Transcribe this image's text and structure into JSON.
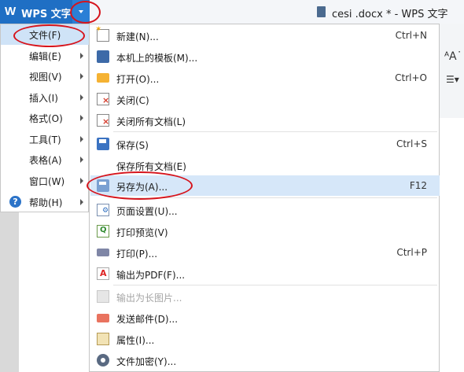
{
  "app": {
    "logo": "W",
    "name": "WPS 文字",
    "doc_title": "cesi .docx * - WPS 文字"
  },
  "background": {
    "toolbar_glyph_1": "ᴬA˙",
    "toolbar_glyph_2": "☰▾"
  },
  "left_menu": [
    {
      "label": "文件(F)",
      "arrow": false,
      "selected": true
    },
    {
      "label": "编辑(E)",
      "arrow": true
    },
    {
      "label": "视图(V)",
      "arrow": true
    },
    {
      "label": "插入(I)",
      "arrow": true
    },
    {
      "label": "格式(O)",
      "arrow": true
    },
    {
      "label": "工具(T)",
      "arrow": true
    },
    {
      "label": "表格(A)",
      "arrow": true
    },
    {
      "label": "窗口(W)",
      "arrow": true
    },
    {
      "label": "帮助(H)",
      "arrow": true,
      "icon": "help-icon",
      "icon_glyph": "?"
    }
  ],
  "file_menu": [
    {
      "label": "新建(N)...",
      "shortcut": "Ctrl+N",
      "icon": "new-doc-icon"
    },
    {
      "label": "本机上的模板(M)...",
      "shortcut": "",
      "icon": "template-icon"
    },
    {
      "label": "打开(O)...",
      "shortcut": "Ctrl+O",
      "icon": "open-folder-icon"
    },
    {
      "label": "关闭(C)",
      "shortcut": "",
      "icon": "close-doc-icon"
    },
    {
      "label": "关闭所有文档(L)",
      "shortcut": "",
      "icon": "close-all-icon"
    },
    {
      "label": "保存(S)",
      "shortcut": "Ctrl+S",
      "icon": "save-icon"
    },
    {
      "label": "保存所有文档(E)",
      "shortcut": "",
      "icon": ""
    },
    {
      "label": "另存为(A)...",
      "shortcut": "F12",
      "icon": "save-as-icon",
      "highlighted": true
    },
    {
      "label": "页面设置(U)...",
      "shortcut": "",
      "icon": "page-setup-icon"
    },
    {
      "label": "打印预览(V)",
      "shortcut": "",
      "icon": "print-preview-icon"
    },
    {
      "label": "打印(P)...",
      "shortcut": "Ctrl+P",
      "icon": "printer-icon"
    },
    {
      "label": "输出为PDF(F)...",
      "shortcut": "",
      "icon": "pdf-icon"
    },
    {
      "label": "输出为长图片...",
      "shortcut": "",
      "icon": "long-image-icon",
      "disabled": true
    },
    {
      "label": "发送邮件(D)...",
      "shortcut": "",
      "icon": "mail-icon"
    },
    {
      "label": "属性(I)...",
      "shortcut": "",
      "icon": "properties-icon"
    },
    {
      "label": "文件加密(Y)...",
      "shortcut": "",
      "icon": "encrypt-icon"
    }
  ],
  "colors": {
    "title_accent": "#1f6fc4",
    "highlight": "#d6e7f9",
    "annotation": "#d6141c"
  }
}
